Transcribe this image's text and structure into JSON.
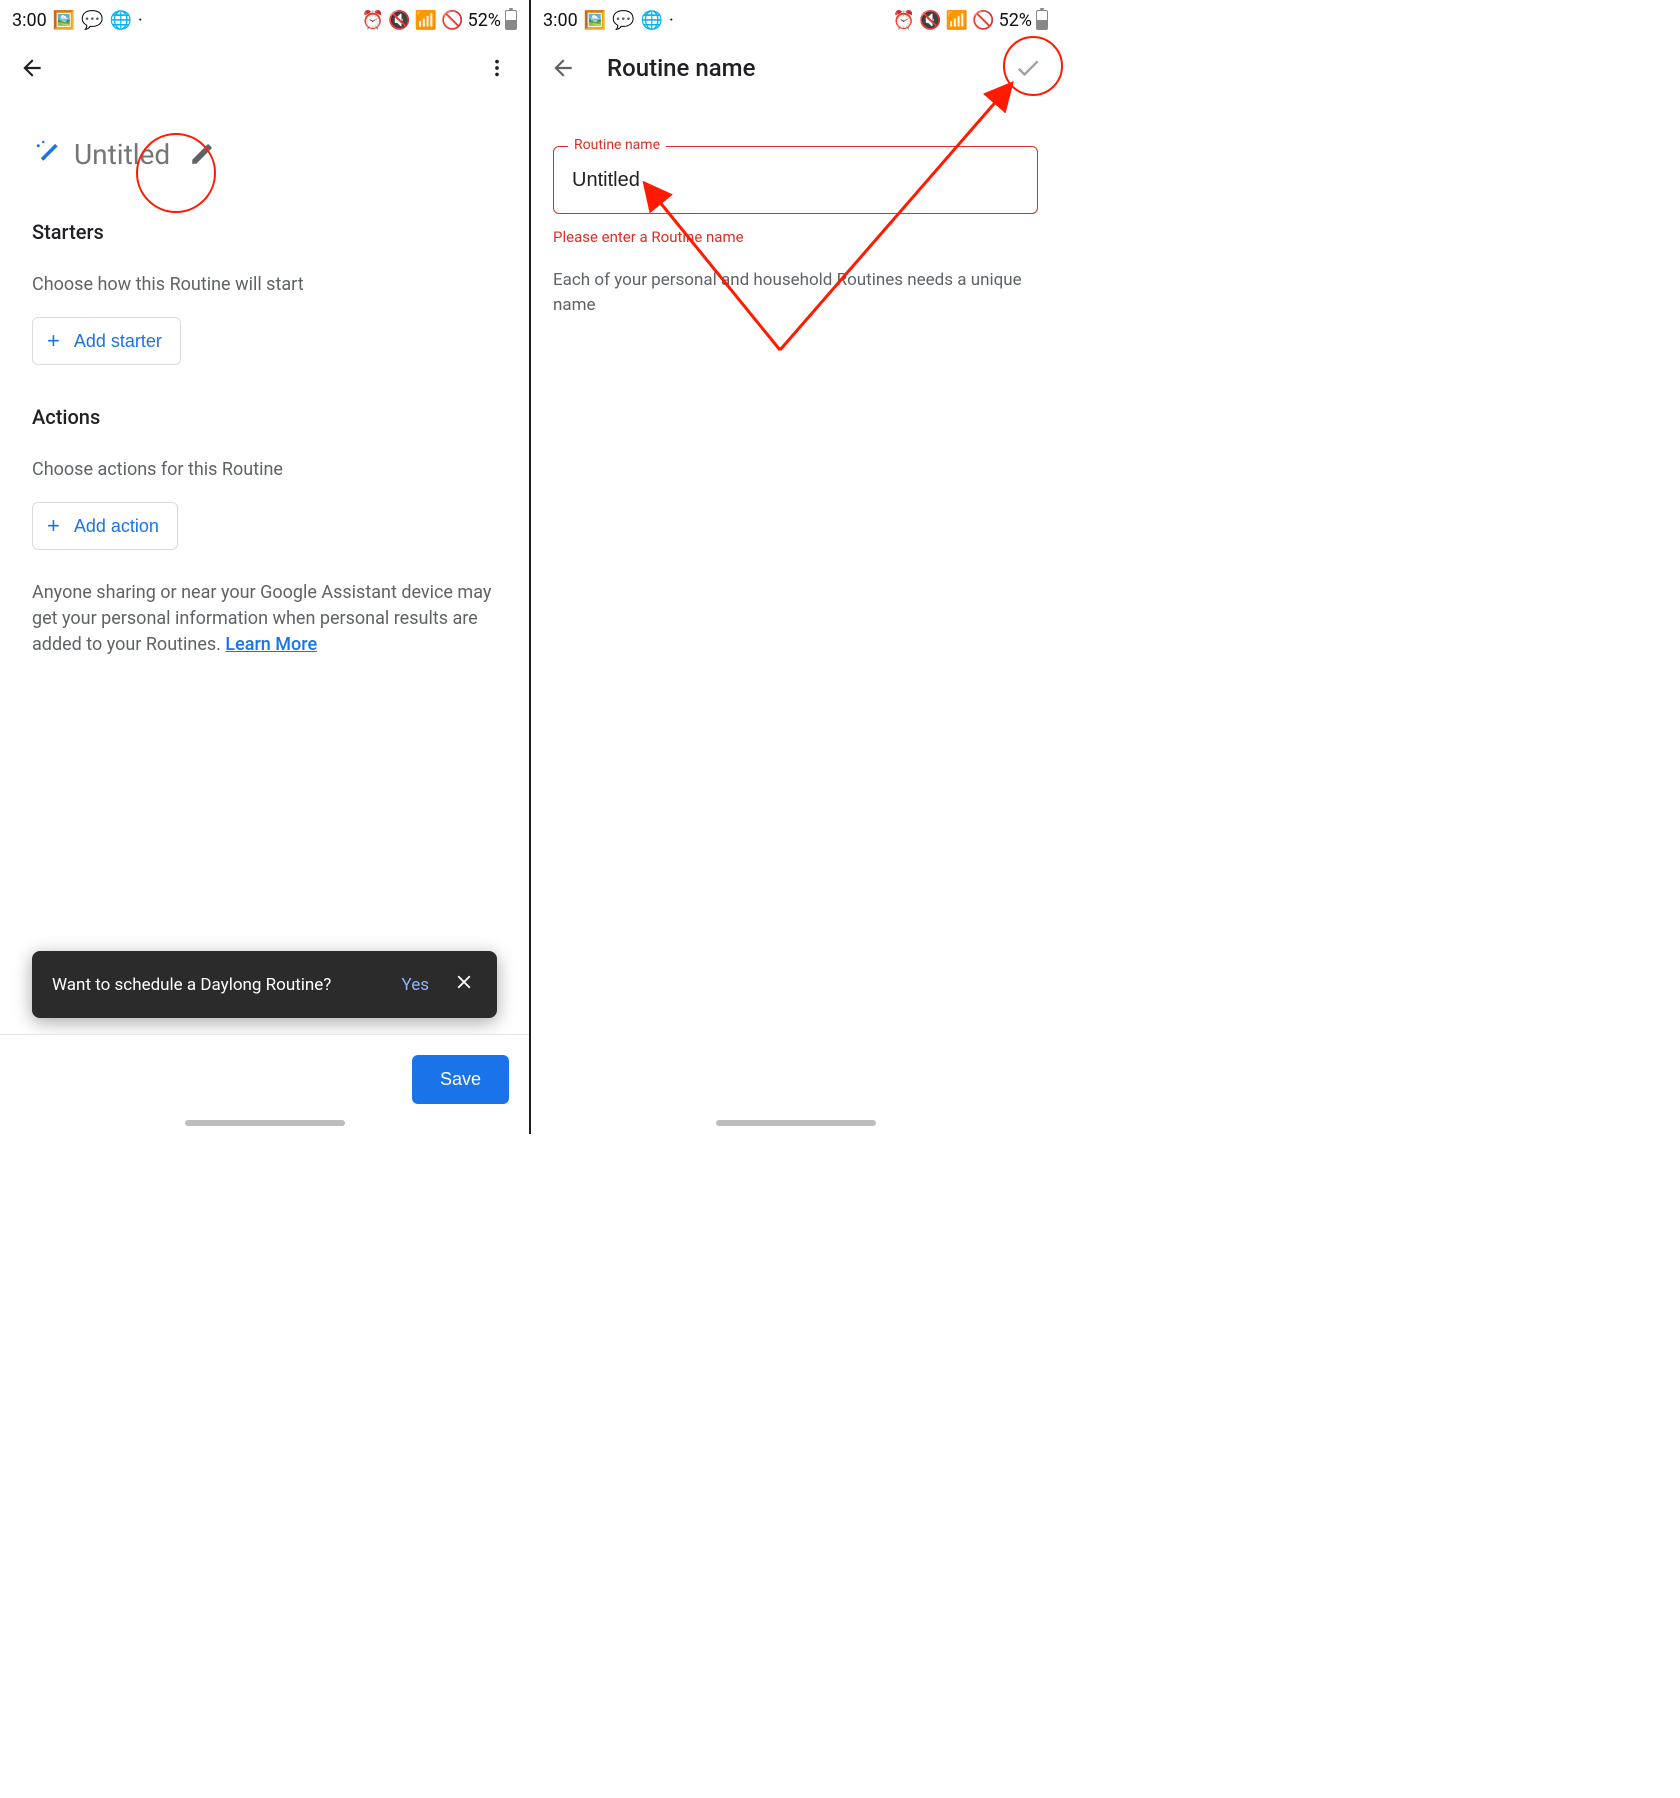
{
  "status": {
    "time": "3:00",
    "battery": "52%"
  },
  "left": {
    "title": "Untitled",
    "sections": {
      "starters": {
        "heading": "Starters",
        "sub": "Choose how this Routine will start",
        "add_label": "Add starter"
      },
      "actions": {
        "heading": "Actions",
        "sub": "Choose actions for this Routine",
        "add_label": "Add action"
      }
    },
    "disclaimer": {
      "text": "Anyone sharing or near your Google Assistant device may get your personal information when personal results are added to your Routines. ",
      "link": "Learn More"
    },
    "snackbar": {
      "text": "Want to schedule a Daylong Routine?",
      "yes": "Yes"
    },
    "save_label": "Save"
  },
  "right": {
    "header_title": "Routine name",
    "field": {
      "legend": "Routine name",
      "value": "Untitled",
      "error": "Please enter a Routine name",
      "help": "Each of your personal and household Routines needs a unique name"
    }
  }
}
